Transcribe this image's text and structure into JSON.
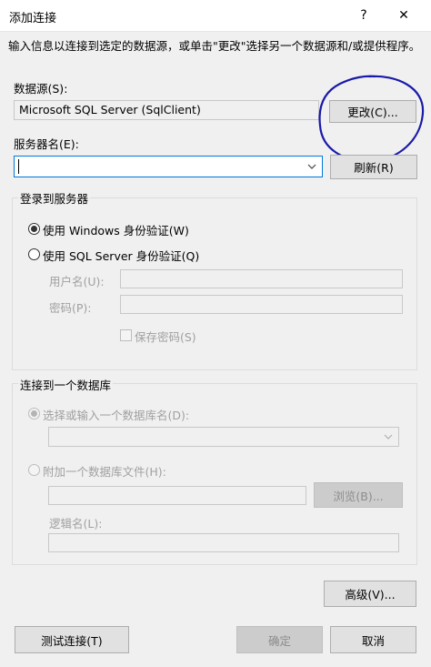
{
  "window": {
    "title": "添加连接",
    "help": "?",
    "close": "✕"
  },
  "instructions": "输入信息以连接到选定的数据源，或单击\"更改\"选择另一个数据源和/或提供程序。",
  "datasource": {
    "label": "数据源(S):",
    "value": "Microsoft SQL Server (SqlClient)",
    "change_button": "更改(C)..."
  },
  "server": {
    "label": "服务器名(E):",
    "value": "",
    "refresh_button": "刷新(R)"
  },
  "login": {
    "group_label": "登录到服务器",
    "windows_auth": "使用 Windows 身份验证(W)",
    "sql_auth": "使用 SQL Server 身份验证(Q)",
    "username_label": "用户名(U):",
    "password_label": "密码(P):",
    "save_password": "保存密码(S)"
  },
  "database": {
    "group_label": "连接到一个数据库",
    "select_option": "选择或输入一个数据库名(D):",
    "attach_option": "附加一个数据库文件(H):",
    "browse_button": "浏览(B)...",
    "logical_name_label": "逻辑名(L):"
  },
  "buttons": {
    "advanced": "高级(V)...",
    "test": "测试连接(T)",
    "ok": "确定",
    "cancel": "取消"
  },
  "annotation_color": "#1a1aa8"
}
